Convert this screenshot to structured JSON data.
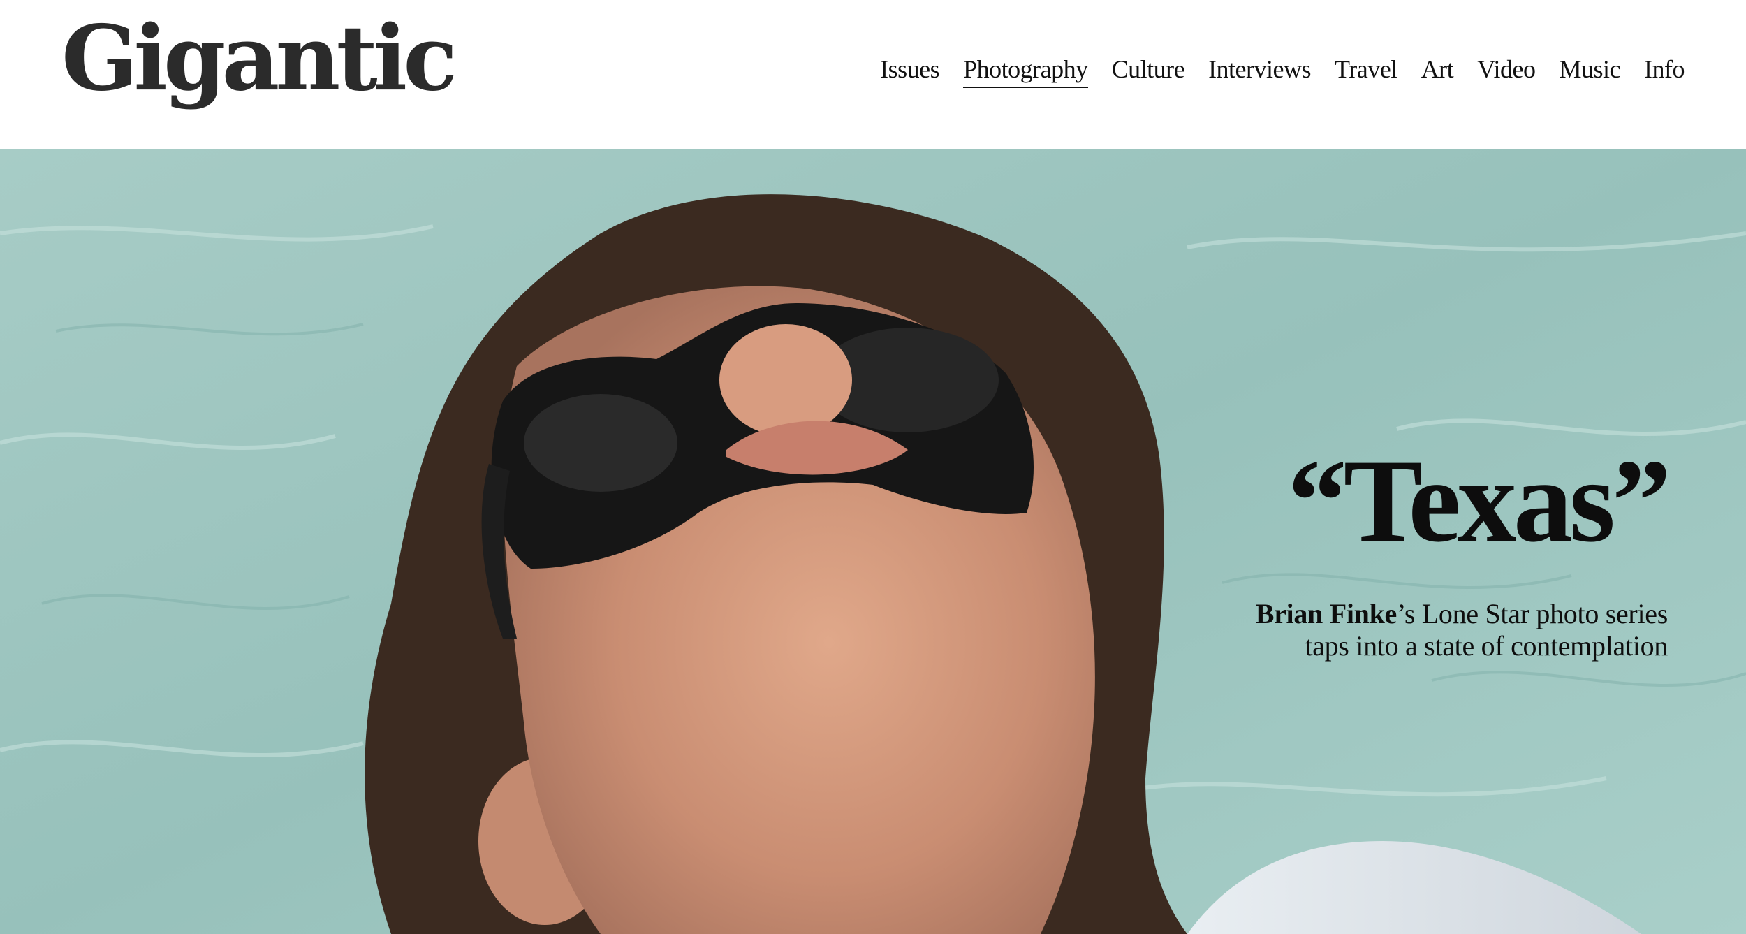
{
  "site": {
    "logo": "Gigantic"
  },
  "nav": {
    "items": [
      {
        "label": "Issues"
      },
      {
        "label": "Photography",
        "active": true
      },
      {
        "label": "Culture"
      },
      {
        "label": "Interviews"
      },
      {
        "label": "Travel"
      },
      {
        "label": "Art"
      },
      {
        "label": "Video"
      },
      {
        "label": "Music"
      },
      {
        "label": "Info"
      }
    ]
  },
  "hero": {
    "title": "“Texas”",
    "subtitle_name": "Brian Finke",
    "subtitle_rest": "’s Lone Star photo series taps into a state of contemplation"
  },
  "colors": {
    "water": "#9cc3bd",
    "text": "#0d0d0d",
    "logo": "#2b2b2b"
  }
}
